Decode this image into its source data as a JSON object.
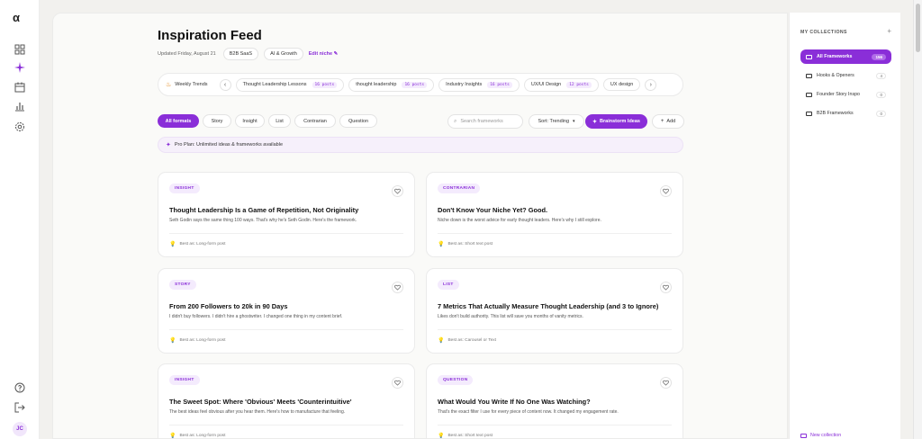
{
  "app": {
    "logo": "α",
    "avatar_initials": "JC"
  },
  "rail_icons": [
    "dashboard-icon",
    "sparkle-icon",
    "calendar-icon",
    "analytics-icon",
    "settings-icon",
    "help-icon",
    "logout-icon"
  ],
  "header": {
    "title": "Inspiration Feed",
    "updated": "Updated Friday, August 21",
    "niches": [
      "B2B SaaS",
      "AI & Growth"
    ],
    "edit_niche": "Edit niche ✎"
  },
  "trends": {
    "label": "Weekly Trends",
    "prev": "‹",
    "next": "›",
    "items": [
      {
        "label": "Thought Leadership Lessons",
        "count": "16 posts"
      },
      {
        "label": "thought leadership",
        "count": "16 posts"
      },
      {
        "label": "Industry Insights",
        "count": "16 posts"
      },
      {
        "label": "UX/UI Design",
        "count": "12 posts"
      },
      {
        "label": "UX design",
        "count": ""
      }
    ]
  },
  "filters": {
    "formats": [
      "All formats",
      "Story",
      "Insight",
      "List",
      "Contrarian",
      "Question"
    ],
    "search_placeholder": "Search frameworks",
    "sort": "Sort: Trending",
    "brainstorm": "Brainstorm Ideas",
    "add": "Add"
  },
  "pro_banner": "Pro Plan: Unlimited ideas & frameworks available",
  "cards": [
    {
      "tag": "INSIGHT",
      "title": "Thought Leadership Is a Game of Repetition, Not Originality",
      "desc": "Seth Godin says the same thing 100 ways. That's why he's Seth Godin. Here's the framework.",
      "best": "Best as: Long-form post"
    },
    {
      "tag": "CONTRARIAN",
      "title": "Don't Know Your Niche Yet? Good.",
      "desc": "Niche down is the worst advice for early thought leaders. Here's why I still explore.",
      "best": "Best as: Short text post"
    },
    {
      "tag": "STORY",
      "title": "From 200 Followers to 20k in 90 Days",
      "desc": "I didn't buy followers. I didn't hire a ghostwriter. I changed one thing in my content brief.",
      "best": "Best as: Long-form post"
    },
    {
      "tag": "LIST",
      "title": "7 Metrics That Actually Measure Thought Leadership (and 3 to Ignore)",
      "desc": "Likes don't build authority. This list will save you months of vanity metrics.",
      "best": "Best as: Carousel or Text"
    },
    {
      "tag": "INSIGHT",
      "title": "The Sweet Spot: Where 'Obvious' Meets 'Counterintuitive'",
      "desc": "The best ideas feel obvious after you hear them. Here's how to manufacture that feeling.",
      "best": "Best as: Long-form post"
    },
    {
      "tag": "QUESTION",
      "title": "What Would You Write If No One Was Watching?",
      "desc": "That's the exact filter I use for every piece of content now. It changed my engagement rate.",
      "best": "Best as: Short text post"
    }
  ],
  "collections": {
    "title": "MY COLLECTIONS",
    "add": "+",
    "items": [
      {
        "label": "All Frameworks",
        "count": "156"
      },
      {
        "label": "Hooks & Openers",
        "count": "4"
      },
      {
        "label": "Founder Story Inspo",
        "count": "0"
      },
      {
        "label": "B2B Frameworks",
        "count": "0"
      }
    ],
    "new_collection": "New collection"
  },
  "colors": {
    "accent": "#8a2ed8",
    "accent_soft": "#f4ebfd",
    "background": "#f2f1ee"
  }
}
